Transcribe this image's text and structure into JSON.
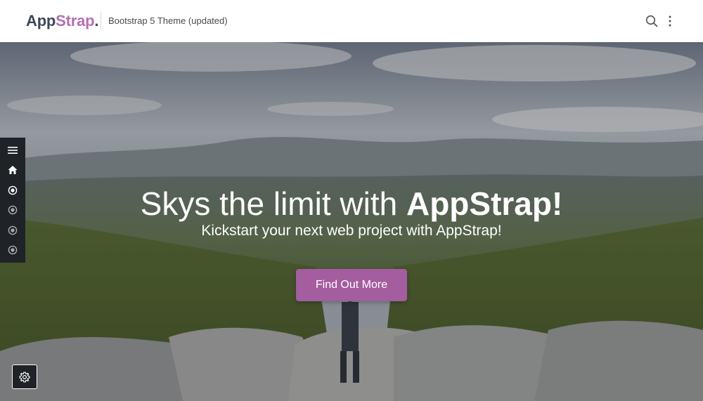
{
  "header": {
    "brand_app": "App",
    "brand_strap": "Strap",
    "brand_dot": ".",
    "subtitle": "Bootstrap 5 Theme (updated)"
  },
  "hero": {
    "headline_light": "Skys the limit with ",
    "headline_bold": "AppStrap!",
    "tagline": "Kickstart your next web project with AppStrap!",
    "cta_label": "Find Out More"
  },
  "sidenav": {
    "items": [
      {
        "icon": "menu-icon"
      },
      {
        "icon": "home-icon"
      },
      {
        "icon": "radio-icon",
        "active": true
      },
      {
        "icon": "radio-icon"
      },
      {
        "icon": "radio-icon"
      },
      {
        "icon": "radio-icon"
      }
    ]
  },
  "colors": {
    "brand_dark": "#3c4858",
    "brand_accent": "#b46fb4",
    "cta_bg": "#a45d9e",
    "sidenav_bg": "#1f2226"
  }
}
